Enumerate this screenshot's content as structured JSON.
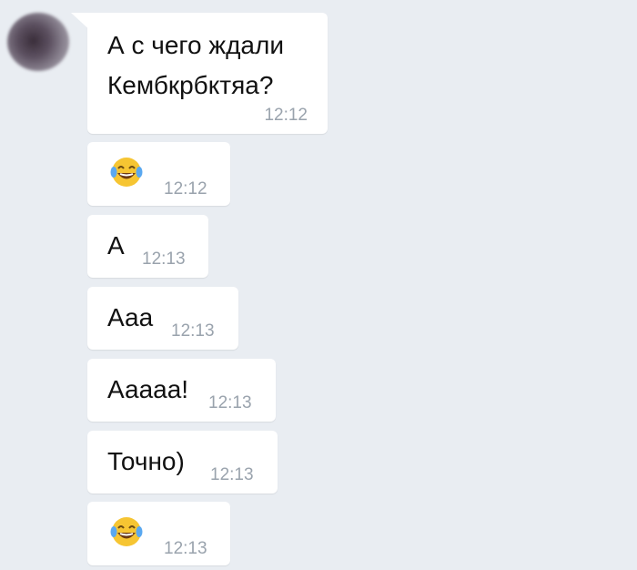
{
  "messages": [
    {
      "text": "А с чего ждали\nКембкрбктяа?",
      "time": "12:12"
    },
    {
      "emoji": "face-with-tears-of-joy",
      "time": "12:12"
    },
    {
      "text": "А",
      "time": "12:13"
    },
    {
      "text": "Ааа",
      "time": "12:13"
    },
    {
      "text": "Ааааа!",
      "time": "12:13"
    },
    {
      "text": "Точно)",
      "time": "12:13"
    },
    {
      "emoji": "face-with-tears-of-joy",
      "time": "12:13"
    }
  ],
  "colors": {
    "background": "#e9edf2",
    "bubble": "#ffffff",
    "timestamp": "#9aa3ad",
    "emoji": "#f6c532"
  }
}
